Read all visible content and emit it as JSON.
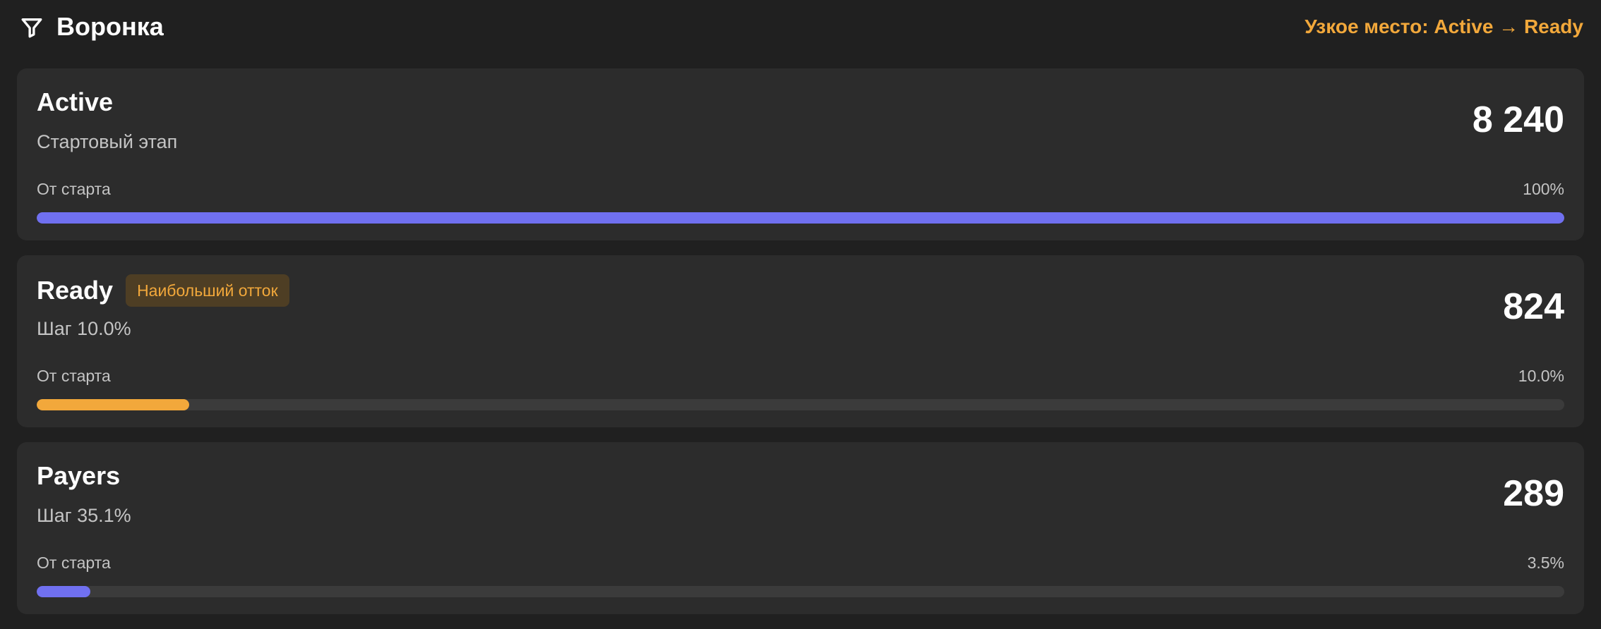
{
  "header": {
    "title": "Воронка",
    "icon": "filter-icon",
    "bottleneck_text": "Узкое место: Active → Ready"
  },
  "colors": {
    "accent": "#7070f0",
    "warning": "#f2a83b",
    "card_bg": "#2c2c2c",
    "page_bg": "#202020"
  },
  "stages": [
    {
      "name": "Active",
      "subtitle": "Стартовый этап",
      "count": "8 240",
      "from_start_label": "От старта",
      "from_start_pct": "100%",
      "progress": 1.0,
      "bar_color": "#7070f0"
    },
    {
      "name": "Ready",
      "badge": "Наибольший отток",
      "subtitle": "Шаг 10.0%",
      "count": "824",
      "from_start_label": "От старта",
      "from_start_pct": "10.0%",
      "progress": 0.1,
      "bar_color": "#f2a83b"
    },
    {
      "name": "Payers",
      "subtitle": "Шаг 35.1%",
      "count": "289",
      "from_start_label": "От старта",
      "from_start_pct": "3.5%",
      "progress": 0.035,
      "bar_color": "#7070f0"
    }
  ]
}
